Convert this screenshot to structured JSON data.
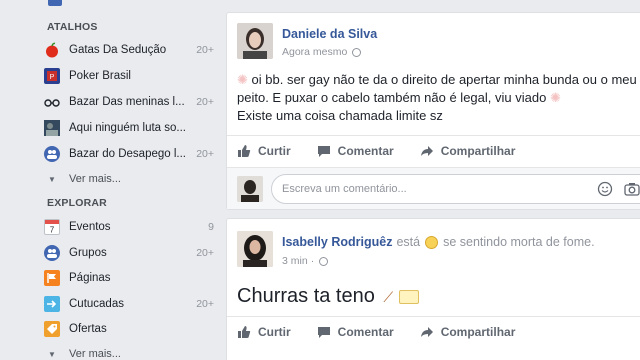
{
  "sidebar": {
    "atalhos_title": "ATALHOS",
    "atalhos": [
      {
        "label": "Gatas Da Sedução",
        "count": "20+",
        "icon": "apple-icon"
      },
      {
        "label": "Poker Brasil",
        "count": "",
        "icon": "poker-icon"
      },
      {
        "label": "Bazar Das meninas l...",
        "count": "20+",
        "icon": "glasses-icon"
      },
      {
        "label": "Aqui ninguém luta so...",
        "count": "",
        "icon": "group-photo-icon"
      },
      {
        "label": "Bazar do Desapego l...",
        "count": "20+",
        "icon": "group-icon"
      }
    ],
    "atalhos_more": "Ver mais...",
    "explorar_title": "EXPLORAR",
    "explorar": [
      {
        "label": "Eventos",
        "count": "9",
        "icon": "calendar-icon"
      },
      {
        "label": "Grupos",
        "count": "20+",
        "icon": "groups-icon"
      },
      {
        "label": "Páginas",
        "count": "",
        "icon": "flag-icon"
      },
      {
        "label": "Cutucadas",
        "count": "20+",
        "icon": "poke-icon"
      },
      {
        "label": "Ofertas",
        "count": "",
        "icon": "offers-icon"
      }
    ],
    "explorar_more": "Ver mais..."
  },
  "post1": {
    "author": "Daniele da Silva",
    "time": "Agora mesmo",
    "text_lines": [
      "oi bb. ser gay não te da o direito de apertar minha bunda ou o meu",
      "peito. E puxar o cabelo também não é legal, viu viado",
      "Existe uma coisa chamada limite sz"
    ],
    "actions": {
      "like": "Curtir",
      "comment": "Comentar",
      "share": "Compartilhar"
    },
    "comment_placeholder": "Escreva um comentário..."
  },
  "post2": {
    "author": "Isabelly Rodriguêz",
    "feeling_prefix": "está",
    "feeling_text": "se sentindo morta de fome.",
    "time": "3 min",
    "text": "Churras ta teno",
    "actions": {
      "like": "Curtir",
      "comment": "Comentar",
      "share": "Compartilhar"
    }
  },
  "colors": {
    "link": "#365899",
    "muted": "#90949c",
    "accent": "#4267b2"
  }
}
